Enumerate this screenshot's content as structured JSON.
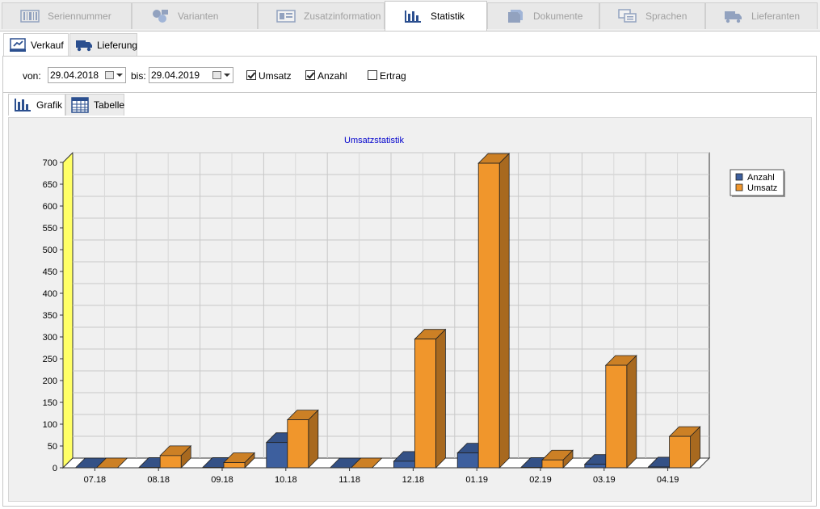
{
  "top_tabs": [
    {
      "label": "Seriennummer",
      "icon": "barcode-icon",
      "active": false
    },
    {
      "label": "Varianten",
      "icon": "variants-icon",
      "active": false
    },
    {
      "label": "Zusatzinformation",
      "icon": "info-card-icon",
      "active": false
    },
    {
      "label": "Statistik",
      "icon": "bar-chart-icon",
      "active": true
    },
    {
      "label": "Dokumente",
      "icon": "document-icon",
      "active": false
    },
    {
      "label": "Sprachen",
      "icon": "languages-icon",
      "active": false
    },
    {
      "label": "Lieferanten",
      "icon": "truck-icon",
      "active": false
    }
  ],
  "sub_tabs": [
    {
      "label": "Verkauf",
      "icon": "sales-icon",
      "active": true
    },
    {
      "label": "Lieferung",
      "icon": "truck-icon",
      "active": false
    }
  ],
  "filter": {
    "from_label": "von:",
    "from_value": "29.04.2018",
    "to_label": "bis:",
    "to_value": "29.04.2019",
    "checkboxes": [
      {
        "label": "Umsatz",
        "checked": true
      },
      {
        "label": "Anzahl",
        "checked": true
      },
      {
        "label": "Ertrag",
        "checked": false
      }
    ]
  },
  "view_tabs": [
    {
      "label": "Grafik",
      "icon": "bar-chart-icon",
      "active": true
    },
    {
      "label": "Tabelle",
      "icon": "table-icon",
      "active": false
    }
  ],
  "colors": {
    "anzahl": "#3d5f9e",
    "umsatz": "#f0962c",
    "axis_wall": "#ffff66"
  },
  "chart_data": {
    "type": "bar",
    "title": "Umsatzstatistik",
    "categories": [
      "07.18",
      "08.18",
      "09.18",
      "10.18",
      "11.18",
      "12.18",
      "01.19",
      "02.19",
      "03.19",
      "04.19"
    ],
    "series": [
      {
        "name": "Anzahl",
        "values": [
          0,
          1,
          1,
          58,
          0,
          15,
          34,
          1,
          8,
          2
        ]
      },
      {
        "name": "Umsatz",
        "values": [
          0,
          28,
          12,
          110,
          0,
          295,
          698,
          18,
          235,
          72
        ]
      }
    ],
    "yticks": [
      "0",
      "50",
      "100",
      "150",
      "200",
      "250",
      "300",
      "350",
      "400",
      "450",
      "500",
      "550",
      "600",
      "650",
      "700"
    ],
    "ylim": [
      0,
      700
    ],
    "legend": "top-right",
    "grid": true
  }
}
